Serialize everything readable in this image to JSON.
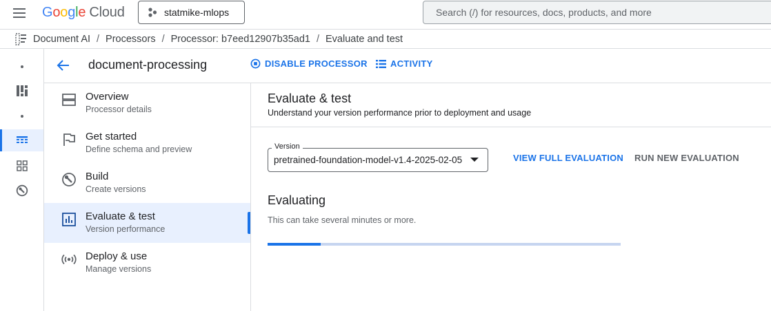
{
  "header": {
    "logo": {
      "g1": "G",
      "g2": "o",
      "g3": "o",
      "g4": "g",
      "g5": "l",
      "g6": "e",
      "cloud": "Cloud"
    },
    "project_name": "statmike-mlops",
    "search_placeholder": "Search (/) for resources, docs, products, and more"
  },
  "breadcrumb": [
    "Document AI",
    "Processors",
    "Processor: b7eed12907b35ad1",
    "Evaluate and test"
  ],
  "processor": {
    "name": "document-processing",
    "disable_label": "DISABLE PROCESSOR",
    "activity_label": "ACTIVITY"
  },
  "nav": {
    "items": [
      {
        "title": "Overview",
        "subtitle": "Processor details",
        "icon": "overview-icon"
      },
      {
        "title": "Get started",
        "subtitle": "Define schema and preview",
        "icon": "flag-icon"
      },
      {
        "title": "Build",
        "subtitle": "Create versions",
        "icon": "build-icon"
      },
      {
        "title": "Evaluate & test",
        "subtitle": "Version performance",
        "icon": "chart-icon",
        "active": true
      },
      {
        "title": "Deploy & use",
        "subtitle": "Manage versions",
        "icon": "broadcast-icon"
      }
    ]
  },
  "main": {
    "title": "Evaluate & test",
    "subtitle": "Understand your version performance prior to deployment and usage",
    "version_label": "Version",
    "version_value": "pretrained-foundation-model-v1.4-2025-02-05",
    "view_full_label": "VIEW FULL EVALUATION",
    "run_new_label": "RUN NEW EVALUATION",
    "evaluating_title": "Evaluating",
    "evaluating_subtitle": "This can take several minutes or more.",
    "progress_fraction": 0.15
  },
  "colors": {
    "accent": "#1a73e8",
    "disabled_text": "#5f6368",
    "active_bg": "#e8f0fe"
  }
}
